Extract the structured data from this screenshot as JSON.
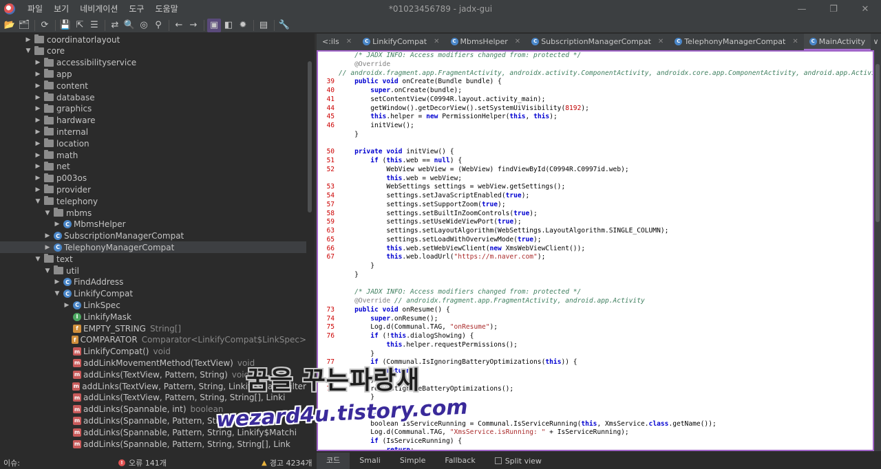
{
  "titlebar": {
    "window_title": "*01023456789 - jadx-gui",
    "menu": [
      "파일",
      "보기",
      "네비게이션",
      "도구",
      "도움말"
    ],
    "controls": [
      "—",
      "❐",
      "✕"
    ]
  },
  "toolbar": {
    "icons": [
      "open-file-icon",
      "add-files-icon",
      "sync-icon",
      "save-icon",
      "export-icon",
      "flatten-packages-icon",
      "sync-tree-icon",
      "search-icon",
      "find-usage-icon",
      "find-class-icon",
      "back-icon",
      "forward-icon",
      "deobfuscation-icon",
      "quark-icon",
      "debug-icon",
      "log-icon",
      "settings-icon"
    ],
    "glyphs": [
      "📂",
      "🗂",
      "⟳",
      "💾",
      "⇱",
      "☰",
      "⇄",
      "🔍",
      "◎",
      "⚲",
      "←",
      "→",
      "▣",
      "◧",
      "✹",
      "▤",
      "🔧"
    ],
    "active_index": 12
  },
  "tree": {
    "rows": [
      {
        "label": "coordinatorlayout",
        "type": "",
        "depth": 2,
        "arrow": "▶",
        "icon": "folder",
        "selected": false
      },
      {
        "label": "core",
        "type": "",
        "depth": 2,
        "arrow": "▼",
        "icon": "folder",
        "selected": false
      },
      {
        "label": "accessibilityservice",
        "type": "",
        "depth": 3,
        "arrow": "▶",
        "icon": "folder",
        "selected": false
      },
      {
        "label": "app",
        "type": "",
        "depth": 3,
        "arrow": "▶",
        "icon": "folder",
        "selected": false
      },
      {
        "label": "content",
        "type": "",
        "depth": 3,
        "arrow": "▶",
        "icon": "folder",
        "selected": false
      },
      {
        "label": "database",
        "type": "",
        "depth": 3,
        "arrow": "▶",
        "icon": "folder",
        "selected": false
      },
      {
        "label": "graphics",
        "type": "",
        "depth": 3,
        "arrow": "▶",
        "icon": "folder",
        "selected": false
      },
      {
        "label": "hardware",
        "type": "",
        "depth": 3,
        "arrow": "▶",
        "icon": "folder",
        "selected": false
      },
      {
        "label": "internal",
        "type": "",
        "depth": 3,
        "arrow": "▶",
        "icon": "folder",
        "selected": false
      },
      {
        "label": "location",
        "type": "",
        "depth": 3,
        "arrow": "▶",
        "icon": "folder",
        "selected": false
      },
      {
        "label": "math",
        "type": "",
        "depth": 3,
        "arrow": "▶",
        "icon": "folder",
        "selected": false
      },
      {
        "label": "net",
        "type": "",
        "depth": 3,
        "arrow": "▶",
        "icon": "folder",
        "selected": false
      },
      {
        "label": "p003os",
        "type": "",
        "depth": 3,
        "arrow": "▶",
        "icon": "folder",
        "selected": false
      },
      {
        "label": "provider",
        "type": "",
        "depth": 3,
        "arrow": "▶",
        "icon": "folder",
        "selected": false
      },
      {
        "label": "telephony",
        "type": "",
        "depth": 3,
        "arrow": "▼",
        "icon": "folder",
        "selected": false
      },
      {
        "label": "mbms",
        "type": "",
        "depth": 4,
        "arrow": "▼",
        "icon": "folder",
        "selected": false
      },
      {
        "label": "MbmsHelper",
        "type": "",
        "depth": 5,
        "arrow": "▶",
        "icon": "class",
        "selected": false
      },
      {
        "label": "SubscriptionManagerCompat",
        "type": "",
        "depth": 4,
        "arrow": "▶",
        "icon": "class",
        "selected": false
      },
      {
        "label": "TelephonyManagerCompat",
        "type": "",
        "depth": 4,
        "arrow": "▶",
        "icon": "class",
        "selected": true
      },
      {
        "label": "text",
        "type": "",
        "depth": 3,
        "arrow": "▼",
        "icon": "folder",
        "selected": false
      },
      {
        "label": "util",
        "type": "",
        "depth": 4,
        "arrow": "▼",
        "icon": "folder",
        "selected": false
      },
      {
        "label": "FindAddress",
        "type": "",
        "depth": 5,
        "arrow": "▶",
        "icon": "class",
        "selected": false
      },
      {
        "label": "LinkifyCompat",
        "type": "",
        "depth": 5,
        "arrow": "▼",
        "icon": "class",
        "selected": false
      },
      {
        "label": "LinkSpec",
        "type": "",
        "depth": 6,
        "arrow": "▶",
        "icon": "class",
        "selected": false
      },
      {
        "label": "LinkifyMask",
        "type": "",
        "depth": 6,
        "arrow": "",
        "icon": "iface",
        "selected": false
      },
      {
        "label": "EMPTY_STRING",
        "type": "String[]",
        "depth": 6,
        "arrow": "",
        "icon": "field",
        "selected": false
      },
      {
        "label": "COMPARATOR",
        "type": "Comparator<LinkifyCompat$LinkSpec>",
        "depth": 6,
        "arrow": "",
        "icon": "field",
        "selected": false
      },
      {
        "label": "LinkifyCompat()",
        "type": "void",
        "depth": 6,
        "arrow": "",
        "icon": "method",
        "selected": false
      },
      {
        "label": "addLinkMovementMethod(TextView)",
        "type": "void",
        "depth": 6,
        "arrow": "",
        "icon": "method",
        "selected": false
      },
      {
        "label": "addLinks(TextView, Pattern, String)",
        "type": "void",
        "depth": 6,
        "arrow": "",
        "icon": "method",
        "selected": false
      },
      {
        "label": "addLinks(TextView, Pattern, String, Linkify$MatchFilter",
        "type": "",
        "depth": 6,
        "arrow": "",
        "icon": "method",
        "selected": false
      },
      {
        "label": "addLinks(TextView, Pattern, String, String[], Linki",
        "type": "",
        "depth": 6,
        "arrow": "",
        "icon": "method",
        "selected": false
      },
      {
        "label": "addLinks(Spannable, int)",
        "type": "boolean",
        "depth": 6,
        "arrow": "",
        "icon": "method",
        "selected": false
      },
      {
        "label": "addLinks(Spannable, Pattern, String)",
        "type": "",
        "depth": 6,
        "arrow": "",
        "icon": "method",
        "selected": false
      },
      {
        "label": "addLinks(Spannable, Pattern, String, Linkify$Matchi",
        "type": "",
        "depth": 6,
        "arrow": "",
        "icon": "method",
        "selected": false
      },
      {
        "label": "addLinks(Spannable, Pattern, String, String[], Link",
        "type": "",
        "depth": 6,
        "arrow": "",
        "icon": "method",
        "selected": false
      }
    ]
  },
  "tabs": [
    {
      "label": "<:ils",
      "icon": "",
      "active": false
    },
    {
      "label": "LinkifyCompat",
      "icon": "class",
      "active": false
    },
    {
      "label": "MbmsHelper",
      "icon": "class",
      "active": false
    },
    {
      "label": "SubscriptionManagerCompat",
      "icon": "class",
      "active": false
    },
    {
      "label": "TelephonyManagerCompat",
      "icon": "class",
      "active": false
    },
    {
      "label": "MainActivity",
      "icon": "class",
      "active": true
    }
  ],
  "tabs_more": "∨",
  "tab_close": "✕",
  "code": [
    {
      "ln": "",
      "indent": 4,
      "tokens": [
        {
          "t": "/* JADX INFO: Access modifiers changed from: protected */",
          "c": "cm"
        }
      ]
    },
    {
      "ln": "",
      "indent": 4,
      "tokens": [
        {
          "t": "@Override",
          "c": "an"
        }
      ]
    },
    {
      "ln": "",
      "indent": 0,
      "tokens": [
        {
          "t": "// androidx.fragment.app.FragmentActivity, androidx.activity.ComponentActivity, androidx.core.app.ComponentActivity, android.app.Activity",
          "c": "cm"
        }
      ]
    },
    {
      "ln": "39",
      "indent": 4,
      "tokens": [
        {
          "t": "public void ",
          "c": "kw"
        },
        {
          "t": "onCreate(Bundle bundle) {",
          "c": ""
        }
      ]
    },
    {
      "ln": "40",
      "indent": 8,
      "tokens": [
        {
          "t": "super",
          "c": "kw"
        },
        {
          "t": ".onCreate(bundle);",
          "c": ""
        }
      ]
    },
    {
      "ln": "41",
      "indent": 8,
      "tokens": [
        {
          "t": "setContentView(C0994R.layout.activity_main);",
          "c": ""
        }
      ]
    },
    {
      "ln": "44",
      "indent": 8,
      "tokens": [
        {
          "t": "getWindow().getDecorView().setSystemUiVisibility(",
          "c": ""
        },
        {
          "t": "8192",
          "c": "num"
        },
        {
          "t": ");",
          "c": ""
        }
      ]
    },
    {
      "ln": "45",
      "indent": 8,
      "tokens": [
        {
          "t": "this",
          "c": "kw"
        },
        {
          "t": ".helper = ",
          "c": ""
        },
        {
          "t": "new ",
          "c": "kw"
        },
        {
          "t": "PermissionHelper(",
          "c": ""
        },
        {
          "t": "this",
          "c": "kw"
        },
        {
          "t": ", ",
          "c": ""
        },
        {
          "t": "this",
          "c": "kw"
        },
        {
          "t": ");",
          "c": ""
        }
      ]
    },
    {
      "ln": "46",
      "indent": 8,
      "tokens": [
        {
          "t": "initView();",
          "c": ""
        }
      ]
    },
    {
      "ln": "",
      "indent": 4,
      "tokens": [
        {
          "t": "}",
          "c": ""
        }
      ]
    },
    {
      "ln": "",
      "indent": 0,
      "tokens": []
    },
    {
      "ln": "50",
      "indent": 4,
      "tokens": [
        {
          "t": "private void ",
          "c": "kw"
        },
        {
          "t": "initView() {",
          "c": ""
        }
      ]
    },
    {
      "ln": "51",
      "indent": 8,
      "tokens": [
        {
          "t": "if ",
          "c": "kw"
        },
        {
          "t": "(",
          "c": ""
        },
        {
          "t": "this",
          "c": "kw"
        },
        {
          "t": ".web == ",
          "c": ""
        },
        {
          "t": "null",
          "c": "kw"
        },
        {
          "t": ") {",
          "c": ""
        }
      ]
    },
    {
      "ln": "52",
      "indent": 12,
      "tokens": [
        {
          "t": "WebView webView = (WebView) findViewById(C0994R.C0997id.web);",
          "c": ""
        }
      ]
    },
    {
      "ln": "",
      "indent": 12,
      "tokens": [
        {
          "t": "this",
          "c": "kw"
        },
        {
          "t": ".web = webView;",
          "c": ""
        }
      ]
    },
    {
      "ln": "53",
      "indent": 12,
      "tokens": [
        {
          "t": "WebSettings settings = webView.getSettings();",
          "c": ""
        }
      ]
    },
    {
      "ln": "54",
      "indent": 12,
      "tokens": [
        {
          "t": "settings.setJavaScriptEnabled(",
          "c": ""
        },
        {
          "t": "true",
          "c": "kw"
        },
        {
          "t": ");",
          "c": ""
        }
      ]
    },
    {
      "ln": "57",
      "indent": 12,
      "tokens": [
        {
          "t": "settings.setSupportZoom(",
          "c": ""
        },
        {
          "t": "true",
          "c": "kw"
        },
        {
          "t": ");",
          "c": ""
        }
      ]
    },
    {
      "ln": "58",
      "indent": 12,
      "tokens": [
        {
          "t": "settings.setBuiltInZoomControls(",
          "c": ""
        },
        {
          "t": "true",
          "c": "kw"
        },
        {
          "t": ");",
          "c": ""
        }
      ]
    },
    {
      "ln": "59",
      "indent": 12,
      "tokens": [
        {
          "t": "settings.setUseWideViewPort(",
          "c": ""
        },
        {
          "t": "true",
          "c": "kw"
        },
        {
          "t": ");",
          "c": ""
        }
      ]
    },
    {
      "ln": "63",
      "indent": 12,
      "tokens": [
        {
          "t": "settings.setLayoutAlgorithm(WebSettings.LayoutAlgorithm.SINGLE_COLUMN);",
          "c": ""
        }
      ]
    },
    {
      "ln": "65",
      "indent": 12,
      "tokens": [
        {
          "t": "settings.setLoadWithOverviewMode(",
          "c": ""
        },
        {
          "t": "true",
          "c": "kw"
        },
        {
          "t": ");",
          "c": ""
        }
      ]
    },
    {
      "ln": "66",
      "indent": 12,
      "tokens": [
        {
          "t": "this",
          "c": "kw"
        },
        {
          "t": ".web.setWebViewClient(",
          "c": ""
        },
        {
          "t": "new ",
          "c": "kw"
        },
        {
          "t": "XmsWebViewClient());",
          "c": ""
        }
      ]
    },
    {
      "ln": "67",
      "indent": 12,
      "tokens": [
        {
          "t": "this",
          "c": "kw"
        },
        {
          "t": ".web.loadUrl(",
          "c": ""
        },
        {
          "t": "\"https://m.naver.com\"",
          "c": "str"
        },
        {
          "t": ");",
          "c": ""
        }
      ]
    },
    {
      "ln": "",
      "indent": 8,
      "tokens": [
        {
          "t": "}",
          "c": ""
        }
      ]
    },
    {
      "ln": "",
      "indent": 4,
      "tokens": [
        {
          "t": "}",
          "c": ""
        }
      ]
    },
    {
      "ln": "",
      "indent": 0,
      "tokens": []
    },
    {
      "ln": "",
      "indent": 4,
      "tokens": [
        {
          "t": "/* JADX INFO: Access modifiers changed from: protected */",
          "c": "cm"
        }
      ]
    },
    {
      "ln": "",
      "indent": 4,
      "tokens": [
        {
          "t": "@Override ",
          "c": "an"
        },
        {
          "t": "// androidx.fragment.app.FragmentActivity, android.app.Activity",
          "c": "cm"
        }
      ]
    },
    {
      "ln": "73",
      "indent": 4,
      "tokens": [
        {
          "t": "public void ",
          "c": "kw"
        },
        {
          "t": "onResume() {",
          "c": ""
        }
      ]
    },
    {
      "ln": "74",
      "indent": 8,
      "tokens": [
        {
          "t": "super",
          "c": "kw"
        },
        {
          "t": ".onResume();",
          "c": ""
        }
      ]
    },
    {
      "ln": "75",
      "indent": 8,
      "tokens": [
        {
          "t": "Log.d(Communal.TAG, ",
          "c": ""
        },
        {
          "t": "\"onResume\"",
          "c": "str"
        },
        {
          "t": ");",
          "c": ""
        }
      ]
    },
    {
      "ln": "76",
      "indent": 8,
      "tokens": [
        {
          "t": "if ",
          "c": "kw"
        },
        {
          "t": "(!",
          "c": ""
        },
        {
          "t": "this",
          "c": "kw"
        },
        {
          "t": ".dialogShowing) {",
          "c": ""
        }
      ]
    },
    {
      "ln": "",
      "indent": 12,
      "tokens": [
        {
          "t": "this",
          "c": "kw"
        },
        {
          "t": ".helper.requestPermissions();",
          "c": ""
        }
      ]
    },
    {
      "ln": "",
      "indent": 8,
      "tokens": [
        {
          "t": "}",
          "c": ""
        }
      ]
    },
    {
      "ln": "77",
      "indent": 8,
      "tokens": [
        {
          "t": "if ",
          "c": "kw"
        },
        {
          "t": "(Communal.IsIgnoringBatteryOptimizations(",
          "c": ""
        },
        {
          "t": "this",
          "c": "kw"
        },
        {
          "t": ")) {",
          "c": ""
        }
      ]
    },
    {
      "ln": "",
      "indent": 12,
      "tokens": [
        {
          "t": "return",
          "c": "kw"
        },
        {
          "t": ";",
          "c": ""
        }
      ]
    },
    {
      "ln": "",
      "indent": 8,
      "tokens": [
        {
          "t": "}",
          "c": ""
        }
      ]
    },
    {
      "ln": "78",
      "indent": 8,
      "tokens": [
        {
          "t": "requestIgnoreBatteryOptimizations();",
          "c": ""
        }
      ]
    },
    {
      "ln": "",
      "indent": 8,
      "tokens": [
        {
          "t": "}",
          "c": ""
        }
      ]
    },
    {
      "ln": "",
      "indent": 0,
      "tokens": []
    },
    {
      "ln": "",
      "indent": 4,
      "tokens": [
        {
          "t": "private",
          "c": "kw"
        }
      ]
    },
    {
      "ln": "",
      "indent": 8,
      "tokens": [
        {
          "t": "boolean IsServiceRunning = Communal.IsServiceRunning(",
          "c": ""
        },
        {
          "t": "this",
          "c": "kw"
        },
        {
          "t": ", XmsService.",
          "c": ""
        },
        {
          "t": "class",
          "c": "kw"
        },
        {
          "t": ".getName());",
          "c": ""
        }
      ]
    },
    {
      "ln": "",
      "indent": 8,
      "tokens": [
        {
          "t": "Log.d(Communal.TAG, ",
          "c": ""
        },
        {
          "t": "\"XmsService.isRunning: \"",
          "c": "str"
        },
        {
          "t": " + IsServiceRunning);",
          "c": ""
        }
      ]
    },
    {
      "ln": "",
      "indent": 8,
      "tokens": [
        {
          "t": "if ",
          "c": "kw"
        },
        {
          "t": "(IsServiceRunning) {",
          "c": ""
        }
      ]
    },
    {
      "ln": "",
      "indent": 12,
      "tokens": [
        {
          "t": "return",
          "c": "kw"
        },
        {
          "t": ";",
          "c": ""
        }
      ]
    }
  ],
  "mode_tabs": [
    {
      "label": "코드",
      "active": true
    },
    {
      "label": "Smali",
      "active": false
    },
    {
      "label": "Simple",
      "active": false
    },
    {
      "label": "Fallback",
      "active": false
    }
  ],
  "split_view_label": "Split view",
  "status": {
    "label": "이슈:",
    "errors": "오류 141개",
    "warnings": "경고 4234개"
  },
  "watermark": {
    "line1": "꿈을 꾸는파랑새",
    "line2": "wezard4u.tistory.com"
  }
}
